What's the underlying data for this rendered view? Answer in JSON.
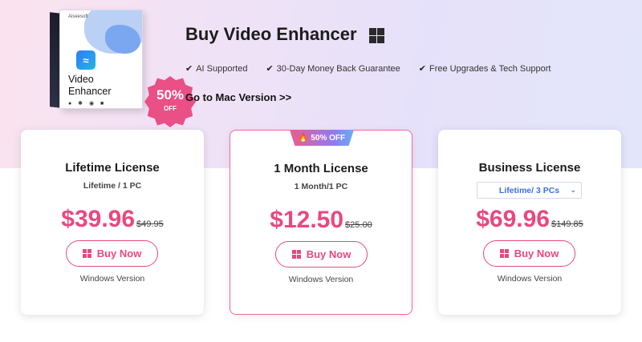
{
  "header": {
    "title": "Buy Video Enhancer",
    "platform_icon": "windows-icon",
    "features": [
      "AI Supported",
      "30-Day Money Back Guarantee",
      "Free Upgrades & Tech Support"
    ],
    "mac_link": "Go to Mac Version >>"
  },
  "product_box": {
    "brand": "Aiseesoft",
    "title_line1": "Video",
    "title_line2": "Enhancer",
    "discount_pct": "50%",
    "discount_off": "OFF"
  },
  "cards": [
    {
      "title": "Lifetime License",
      "subtitle": "Lifetime / 1 PC",
      "price": "$39.96",
      "old_price": "$49.95",
      "buy_label": "Buy Now",
      "platform": "Windows Version"
    },
    {
      "promo": "50% OFF",
      "title": "1 Month License",
      "subtitle": "1 Month/1 PC",
      "price": "$12.50",
      "old_price": "$25.00",
      "buy_label": "Buy Now",
      "platform": "Windows Version"
    },
    {
      "title": "Business License",
      "select_value": "Lifetime/ 3 PCs",
      "price": "$69.96",
      "old_price": "$149.85",
      "buy_label": "Buy Now",
      "platform": "Windows Version"
    }
  ],
  "colors": {
    "accent": "#e9487f",
    "select_text": "#3e6fe0"
  }
}
